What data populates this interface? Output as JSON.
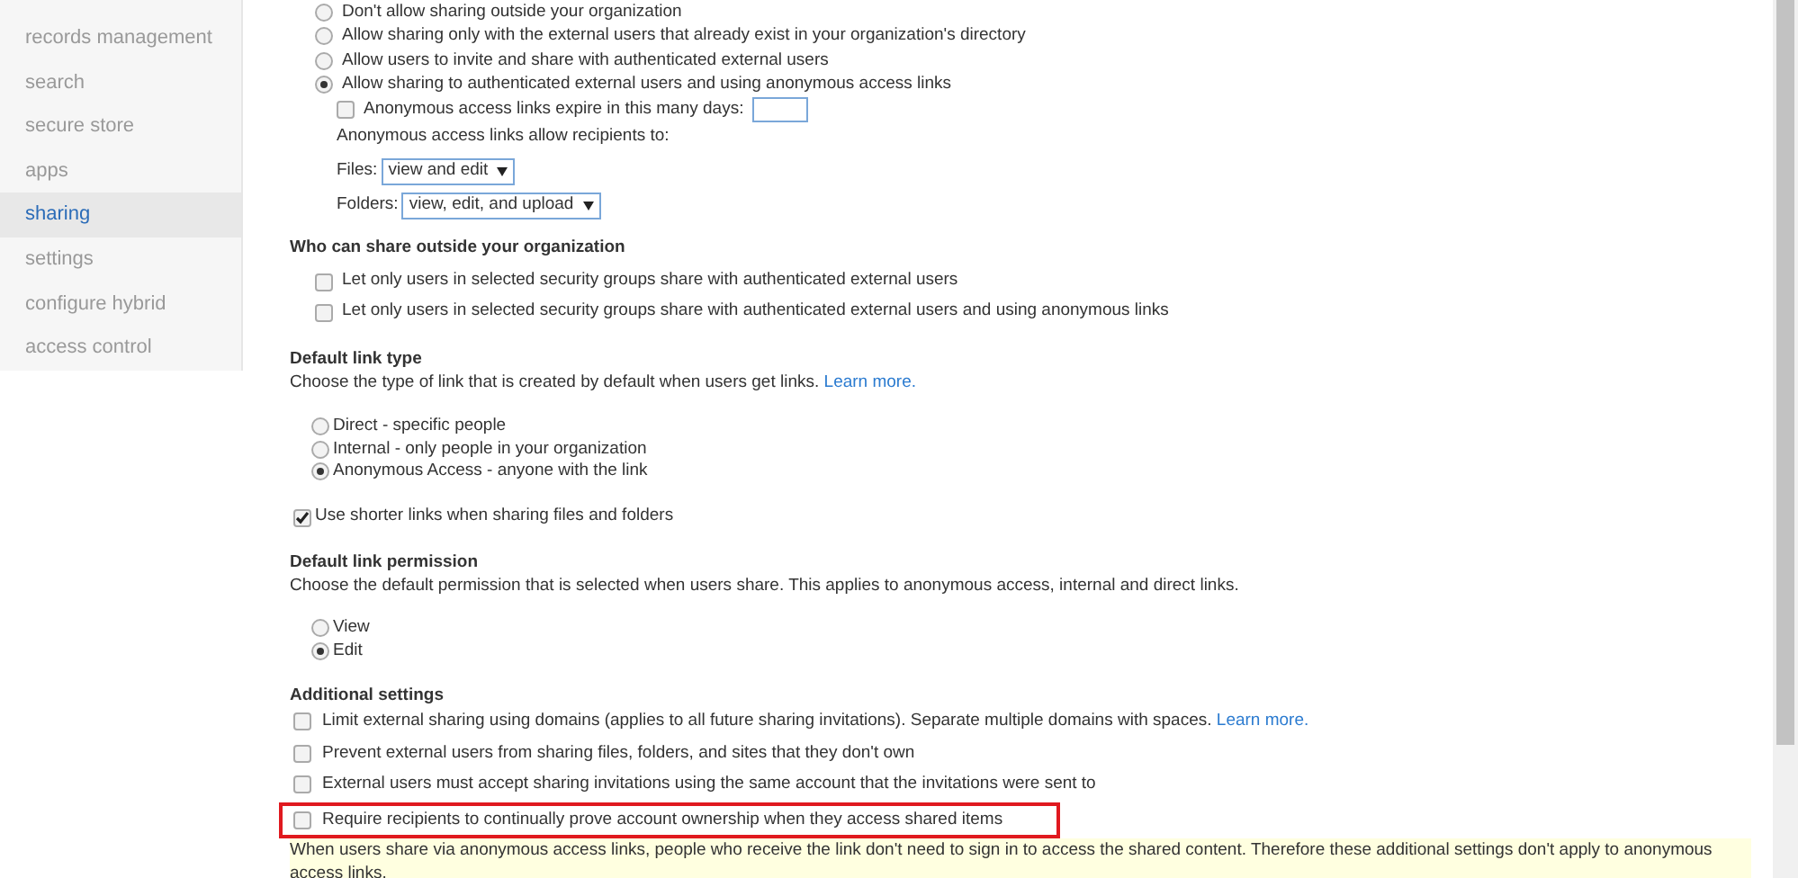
{
  "sidebar": {
    "items": [
      {
        "label": "records management",
        "selected": false
      },
      {
        "label": "search",
        "selected": false
      },
      {
        "label": "secure store",
        "selected": false
      },
      {
        "label": "apps",
        "selected": false
      },
      {
        "label": "sharing",
        "selected": true
      },
      {
        "label": "settings",
        "selected": false
      },
      {
        "label": "configure hybrid",
        "selected": false
      },
      {
        "label": "access control",
        "selected": false
      }
    ]
  },
  "external_sharing": {
    "options": [
      {
        "label": "Don't allow sharing outside your organization",
        "selected": false
      },
      {
        "label": "Allow sharing only with the external users that already exist in your organization's directory",
        "selected": false
      },
      {
        "label": "Allow users to invite and share with authenticated external users",
        "selected": false
      },
      {
        "label": "Allow sharing to authenticated external users and using anonymous access links",
        "selected": true
      }
    ],
    "expire": {
      "label": "Anonymous access links expire in this many days:",
      "checked": false
    },
    "recipients_label": "Anonymous access links allow recipients to:",
    "files": {
      "label": "Files:",
      "value": "view and edit"
    },
    "folders": {
      "label": "Folders:",
      "value": "view, edit, and upload"
    }
  },
  "who_can_share": {
    "heading": "Who can share outside your organization",
    "options": [
      {
        "label": "Let only users in selected security groups share with authenticated external users",
        "checked": false
      },
      {
        "label": "Let only users in selected security groups share with authenticated external users and using anonymous links",
        "checked": false
      }
    ]
  },
  "default_link_type": {
    "heading": "Default link type",
    "description": "Choose the type of link that is created by default when users get links.",
    "link": "Learn more.",
    "options": [
      {
        "label": "Direct - specific people",
        "selected": false
      },
      {
        "label": "Internal - only people in your organization",
        "selected": false
      },
      {
        "label": "Anonymous Access - anyone with the link",
        "selected": true
      }
    ],
    "shorter_links": {
      "label": "Use shorter links when sharing files and folders",
      "checked": true
    }
  },
  "default_link_permission": {
    "heading": "Default link permission",
    "description": "Choose the default permission that is selected when users share. This applies to anonymous access, internal and direct links.",
    "options": [
      {
        "label": "View",
        "selected": false
      },
      {
        "label": "Edit",
        "selected": true
      }
    ]
  },
  "additional_settings": {
    "heading": "Additional settings",
    "options": [
      {
        "label": "Limit external sharing using domains (applies to all future sharing invitations). Separate multiple domains with spaces.",
        "link": "Learn more.",
        "checked": false,
        "highlighted": false
      },
      {
        "label": "Prevent external users from sharing files, folders, and sites that they don't own",
        "checked": false,
        "highlighted": false
      },
      {
        "label": "External users must accept sharing invitations using the same account that the invitations were sent to",
        "checked": false,
        "highlighted": false
      },
      {
        "label": "Require recipients to continually prove account ownership when they access shared items",
        "checked": false,
        "highlighted": true
      }
    ],
    "note": "When users share via anonymous access links, people who receive the link don't need to sign in to access the shared content. Therefore these additional settings don't apply to anonymous access links."
  }
}
